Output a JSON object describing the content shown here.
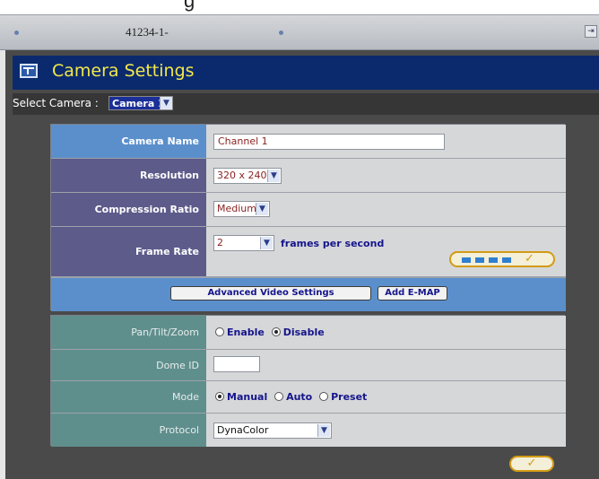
{
  "device": {
    "title": "41234-1-"
  },
  "panel": {
    "title": "Camera Settings",
    "select_camera_label": "Select Camera :",
    "selected_camera": "Camera 1"
  },
  "video": {
    "camera_name_label": "Camera Name",
    "camera_name_value": "Channel 1",
    "resolution_label": "Resolution",
    "resolution_value": "320 x 240",
    "compression_label": "Compression Ratio",
    "compression_value": "Medium",
    "frame_rate_label": "Frame Rate",
    "frame_rate_value": "2",
    "frame_rate_unit": "frames per second",
    "advanced_button": "Advanced Video Settings",
    "emap_button": "Add E-MAP"
  },
  "ptz": {
    "pan_tilt_zoom_label": "Pan/Tilt/Zoom",
    "enable_label": "Enable",
    "disable_label": "Disable",
    "dome_id_label": "Dome ID",
    "dome_id_value": "",
    "mode_label": "Mode",
    "mode_manual": "Manual",
    "mode_auto": "Auto",
    "mode_preset": "Preset",
    "protocol_label": "Protocol",
    "protocol_value": "DynaColor"
  },
  "state": {
    "ptz_enabled": false,
    "mode_selected": "Manual"
  },
  "colors": {
    "header_bg": "#0b2a6e",
    "header_title": "#f2e84a",
    "label_blue": "#5b8fcc",
    "label_purple": "#5d5b8a",
    "label_teal": "#5f8f8d",
    "accent_gold": "#d39b14"
  },
  "icons": {
    "header": "camera-settings-icon",
    "corner": "window-restore-icon",
    "dropdown": "chevron-down-icon",
    "confirm": "checkmark-icon"
  }
}
